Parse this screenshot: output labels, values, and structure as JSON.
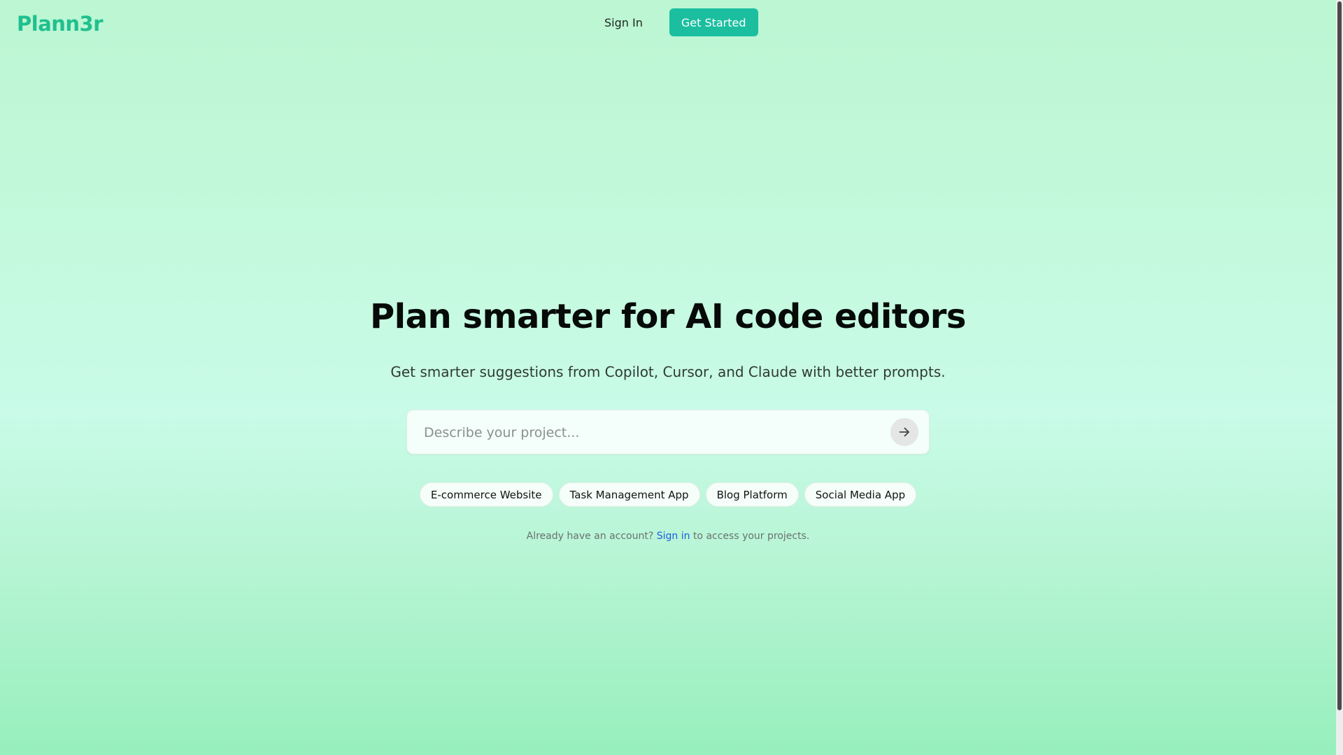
{
  "header": {
    "logo": "Plann3r",
    "signin_label": "Sign In",
    "get_started_label": "Get Started"
  },
  "hero": {
    "title": "Plan smarter for AI code editors",
    "subtitle": "Get smarter suggestions from Copilot, Cursor, and Claude with better prompts.",
    "search": {
      "placeholder": "Describe your project...",
      "value": ""
    },
    "suggestions": [
      "E-commerce Website",
      "Task Management App",
      "Blog Platform",
      "Social Media App"
    ],
    "footnote": {
      "prefix": "Already have an account?",
      "link": "Sign in",
      "suffix": "to access your projects."
    }
  },
  "colors": {
    "brand": "#1fc08e",
    "primary_button": "#1bbfa0",
    "link": "#1a5fe0"
  },
  "icons": {
    "submit": "arrow-right-icon"
  }
}
